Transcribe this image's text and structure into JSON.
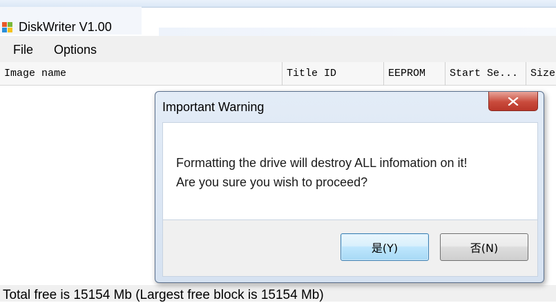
{
  "app": {
    "title": "DiskWriter V1.00",
    "icon": "app-icon"
  },
  "menu": {
    "items": [
      "File",
      "Options"
    ]
  },
  "list": {
    "columns": [
      "Image name",
      "Title ID",
      "EEPROM",
      "Start Se...",
      "Size"
    ]
  },
  "status": {
    "text": "Total free is 15154 Mb  (Largest free block is 15154 Mb)"
  },
  "dialog": {
    "title": "Important Warning",
    "message_line1": "Formatting the drive will destroy ALL infomation on it!",
    "message_line2": "Are you sure you wish to proceed?",
    "yes_label": "是(Y)",
    "no_label": "否(N)",
    "close_icon": "close-icon"
  },
  "colors": {
    "close_button": "#c94b3c",
    "default_button_border": "#3c7fb1",
    "dialog_frame": "#d6e2f1"
  }
}
